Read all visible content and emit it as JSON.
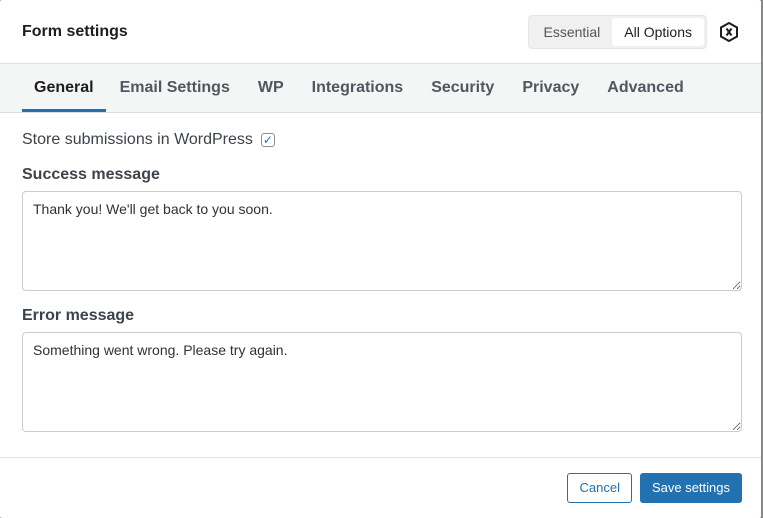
{
  "header": {
    "title": "Form settings",
    "modes": [
      "Essential",
      "All Options"
    ],
    "active_mode": "All Options"
  },
  "tabs": [
    "General",
    "Email Settings",
    "WP",
    "Integrations",
    "Security",
    "Privacy",
    "Advanced"
  ],
  "active_tab": "General",
  "general": {
    "store_label": "Store submissions in WordPress",
    "store_checked": true,
    "success_label": "Success message",
    "success_value": "Thank you! We'll get back to you soon.",
    "error_label": "Error message",
    "error_value": "Something went wrong. Please try again."
  },
  "footer": {
    "cancel": "Cancel",
    "save": "Save settings"
  },
  "colors": {
    "accent": "#2271b1"
  }
}
